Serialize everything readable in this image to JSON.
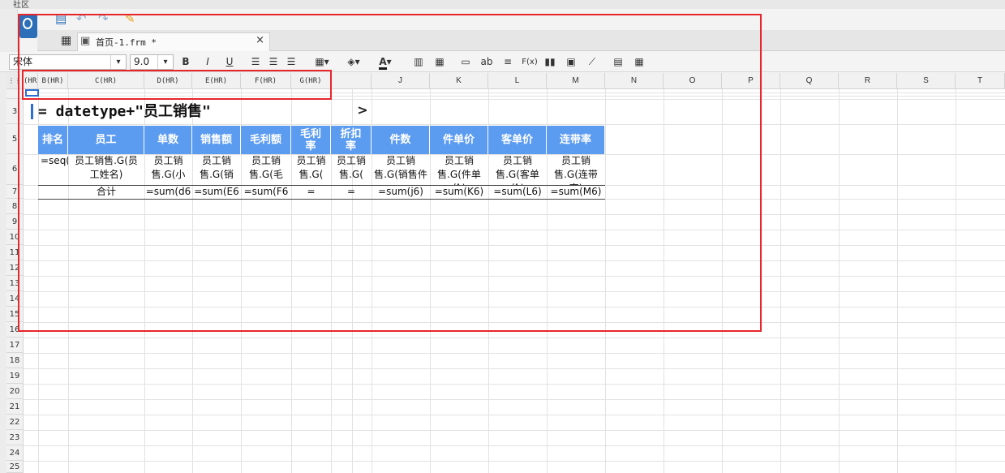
{
  "window": {
    "title": "社区"
  },
  "toolbar": {
    "save_icon": "save-icon",
    "undo_icon": "undo-icon",
    "redo_icon": "redo-icon",
    "brush_icon": "brush-icon"
  },
  "tabs": [
    {
      "label": "首页-1.frm *",
      "close": "×"
    }
  ],
  "format_bar": {
    "font": "宋体",
    "size": "9.0",
    "dropdown": "▾",
    "bold": "B",
    "italic": "I",
    "underline": "U",
    "text_label": "ab",
    "fx_label": "F(x)"
  },
  "column_headers": [
    "(HR)",
    "B(HR)",
    "C(HR)",
    "D(HR)",
    "E(HR)",
    "F(HR)",
    "G(HR)",
    "",
    "J",
    "K",
    "L",
    "M",
    "N",
    "O",
    "P",
    "Q",
    "R",
    "S",
    "T"
  ],
  "row_numbers": [
    "3",
    "5",
    "6",
    "7",
    "8",
    "9",
    "10",
    "11",
    "12",
    "13",
    "14",
    "15",
    "16",
    "17",
    "18",
    "19",
    "20",
    "21",
    "22",
    "23",
    "24",
    "25"
  ],
  "formula_cell": "= datetype+\"员工销售\"",
  "expand_arrow": ">",
  "table": {
    "headers": [
      "排名",
      "员工",
      "单数",
      "销售额",
      "毛利额",
      "毛利率",
      "折扣率",
      "件数",
      "件单价",
      "客单价",
      "连带率"
    ],
    "data": [
      "=seq()",
      "员工销售.G(员工姓名)",
      "员工销售.G(小",
      "员工销售.G(销",
      "员工销售.G(毛",
      "员工销售.G(",
      "员工销售.G(",
      "员工销售.G(销售件",
      "员工销售.G(件单价)",
      "员工销售.G(客单价)",
      "员工销售.G(连带率)"
    ],
    "sum_row": [
      "",
      "合计",
      "=sum(d6",
      "=sum(E6",
      "=sum(F6",
      "=",
      "=",
      "=sum(j6)",
      "=sum(K6)",
      "=sum(L6)",
      "=sum(M6)"
    ]
  },
  "colors": {
    "header_fill": "#5b9bf0",
    "annotation": "#e8262a",
    "accent": "#2c6fb8"
  }
}
